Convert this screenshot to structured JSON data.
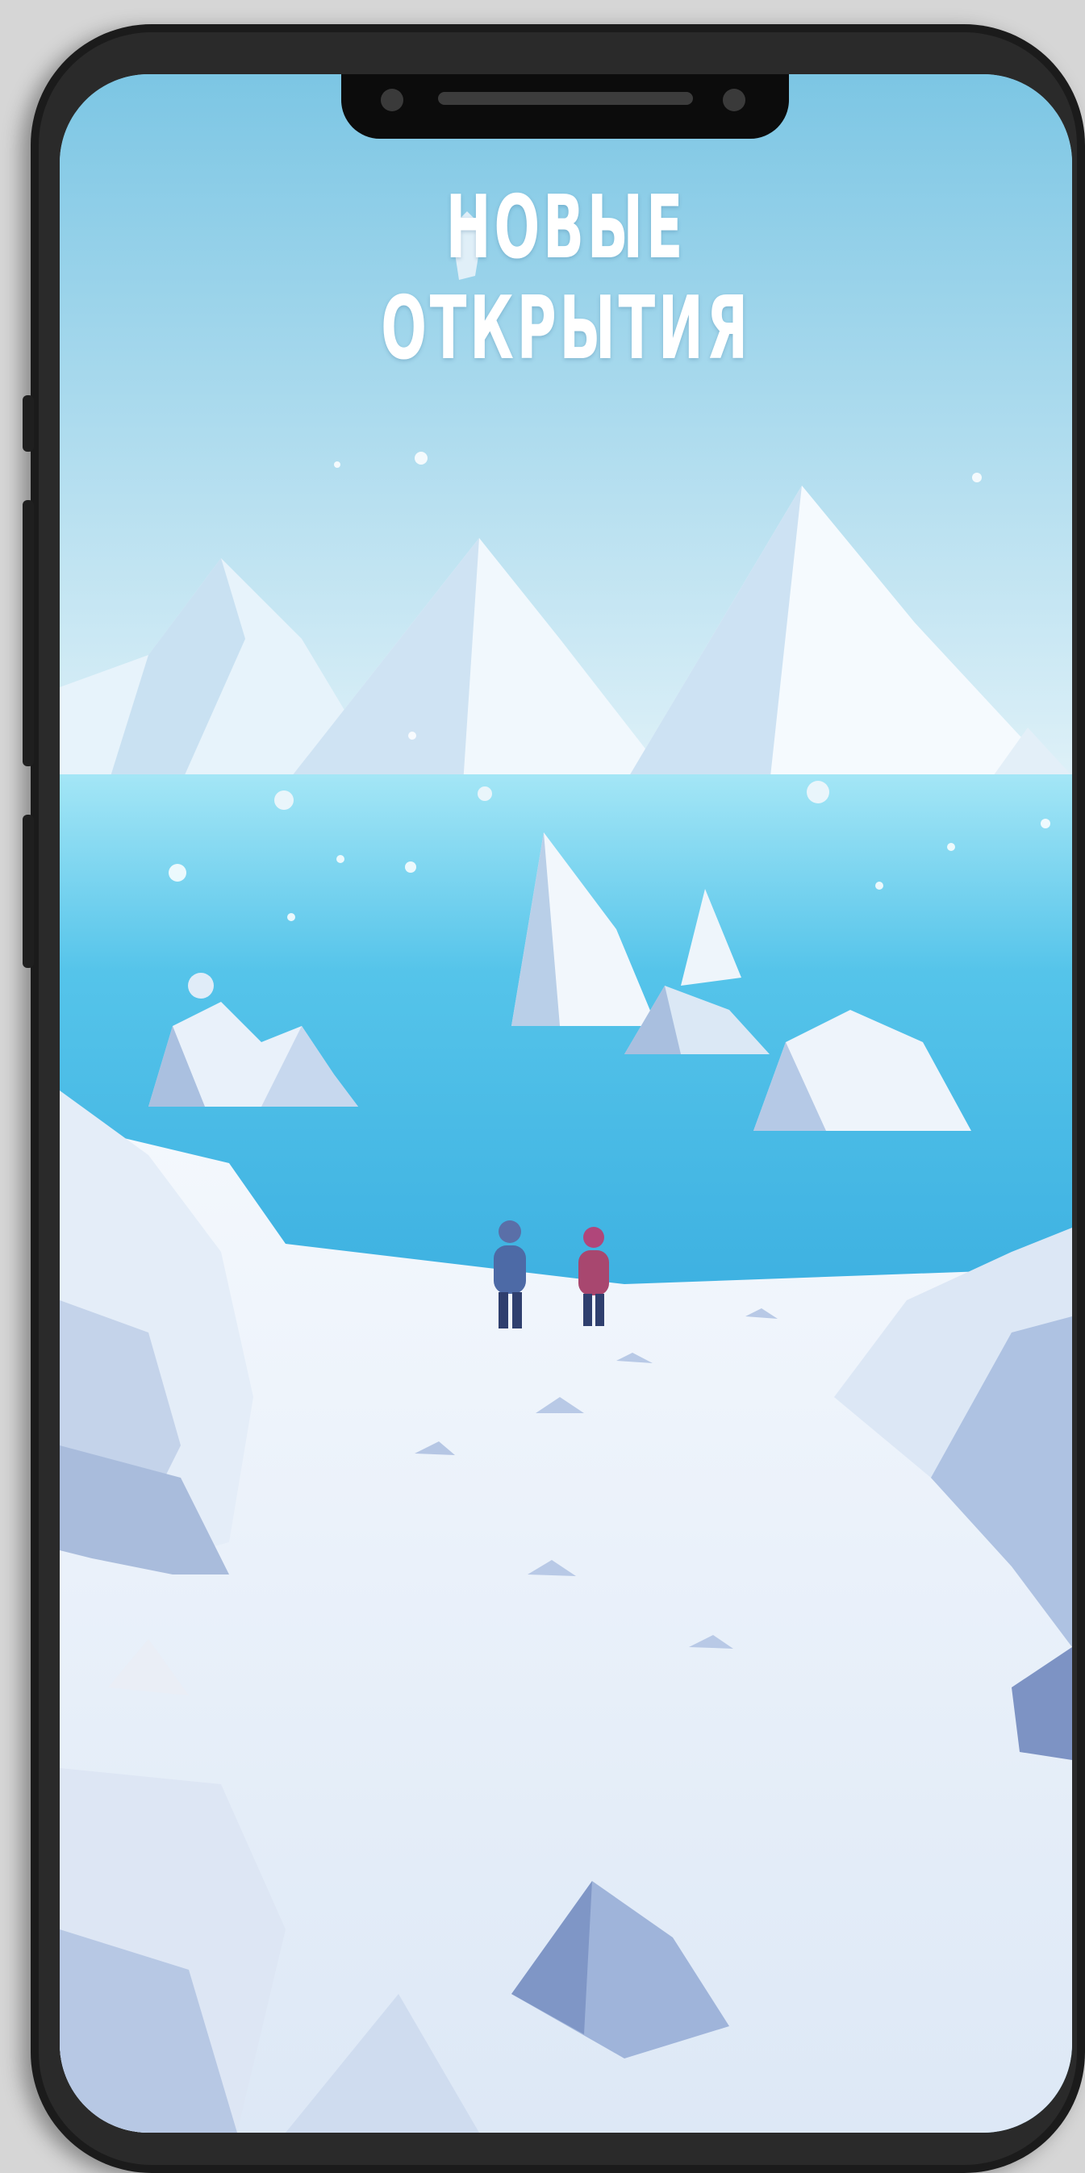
{
  "screen": {
    "headline": "НОВЫЕ ОТКРЫТИЯ"
  },
  "colors": {
    "sky_top": "#7cc6e4",
    "sky_bottom": "#dff1f8",
    "water": "#3fb6e4",
    "snow": "#eef4fb",
    "ice_shadow": "#8fa6d4",
    "phone_frame": "#1b1b1b"
  }
}
